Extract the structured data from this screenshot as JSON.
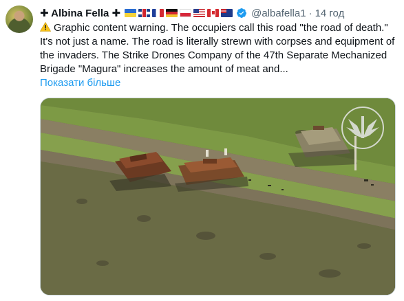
{
  "author": {
    "display_name": "✚ Albina Fella ✚",
    "flags": [
      "ua",
      "gb",
      "fr",
      "de",
      "pl",
      "us",
      "ca",
      "au"
    ],
    "verified_icon": "verified-badge-icon",
    "handle": "@albafella1",
    "separator": "·",
    "time": "14 год"
  },
  "tweet": {
    "warning_icon": "warning-icon",
    "text": "Graphic content warning. The occupiers call this road \"the road of death.\" It's not just a name. The road is literally strewn with corpses and equipment of the invaders. The Strike Drones Company of the 47th Separate Mechanized Brigade \"Magura\" increases the amount of meat and...",
    "show_more": "Показати більше"
  },
  "media": {
    "type": "aerial photo",
    "watermark_icon": "brigade-emblem-icon"
  }
}
